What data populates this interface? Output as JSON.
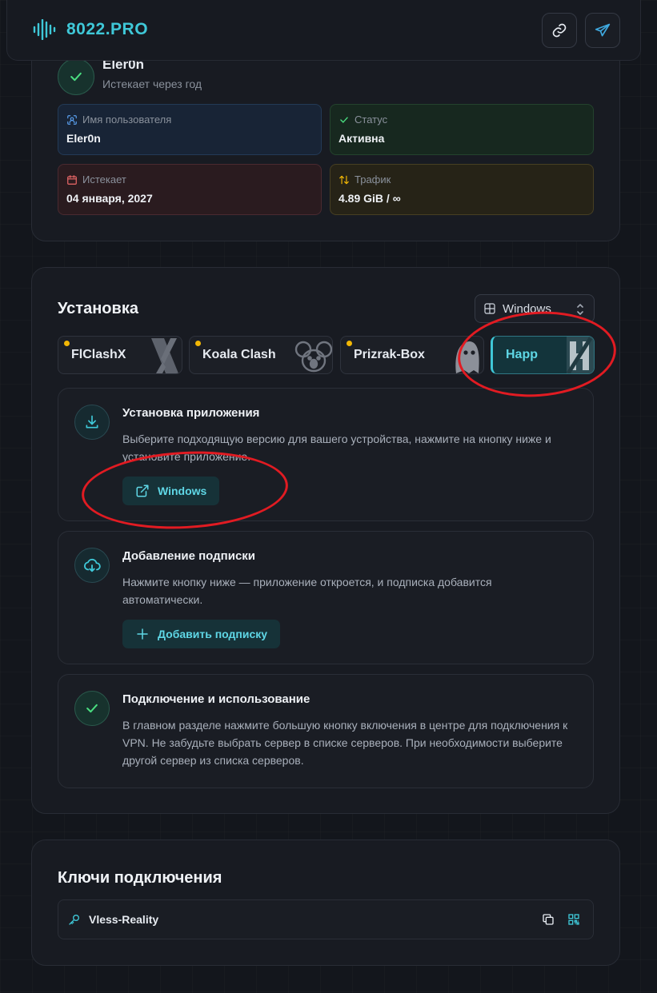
{
  "header": {
    "brand": "8022.PRO",
    "icons": [
      "waveform-logo-icon",
      "link-icon",
      "telegram-send-icon"
    ]
  },
  "profile": {
    "name": "Eler0n",
    "subtitle": "Истекает через год",
    "stats": {
      "username_label": "Имя пользователя",
      "username_value": "Eler0n",
      "status_label": "Статус",
      "status_value": "Активна",
      "expires_label": "Истекает",
      "expires_value": "04 января, 2027",
      "traffic_label": "Трафик",
      "traffic_value": "4.89 GiB / ∞"
    }
  },
  "install": {
    "title": "Установка",
    "os_select": "Windows",
    "apps": [
      {
        "label": "FlClashX",
        "active": false,
        "badge": true
      },
      {
        "label": "Koala Clash",
        "active": false,
        "badge": true
      },
      {
        "label": "Prizrak-Box",
        "active": false,
        "badge": true
      },
      {
        "label": "Happ",
        "active": true,
        "badge": false
      }
    ],
    "steps": [
      {
        "title": "Установка приложения",
        "text": "Выберите подходящую версию для вашего устройства, нажмите на кнопку ниже и установите приложение.",
        "button": "Windows"
      },
      {
        "title": "Добавление подписки",
        "text": "Нажмите кнопку ниже — приложение откроется, и подписка добавится автоматически.",
        "button": "Добавить подписку"
      },
      {
        "title": "Подключение и использование",
        "text": "В главном разделе нажмите большую кнопку включения в центре для подключения к VPN. Не забудьте выбрать сервер в списке серверов. При необходимости выберите другой сервер из списка серверов."
      }
    ]
  },
  "keys": {
    "title": "Ключи подключения",
    "items": [
      {
        "label": "Vless-Reality"
      }
    ]
  },
  "colors": {
    "accent": "#3fc8d8",
    "success": "#4ade80",
    "annotation": "#e11b22",
    "badge": "#f2b705"
  }
}
